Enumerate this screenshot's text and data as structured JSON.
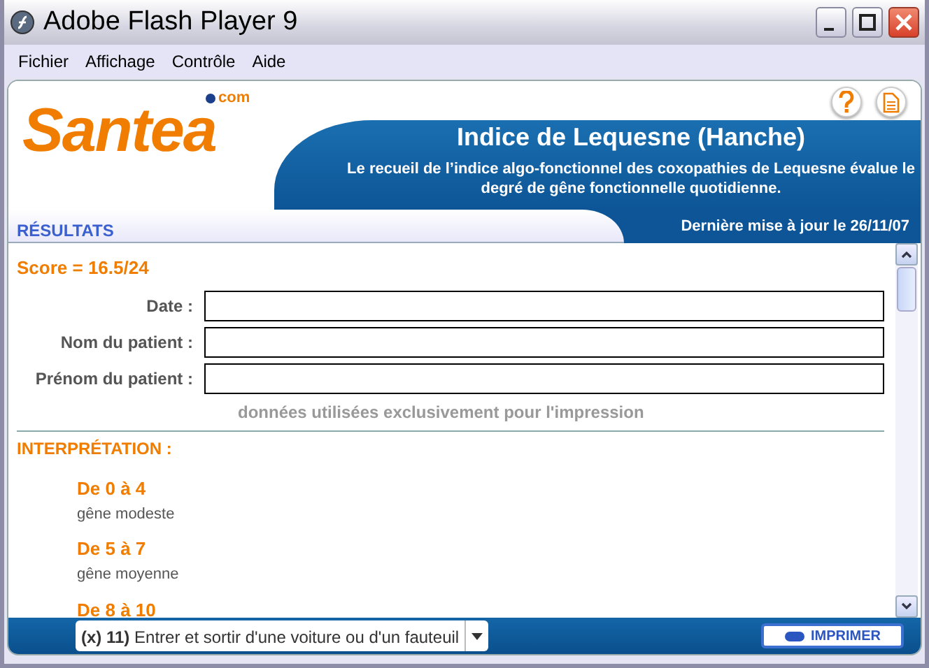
{
  "window": {
    "title": "Adobe Flash Player 9"
  },
  "menu": [
    "Fichier",
    "Affichage",
    "Contrôle",
    "Aide"
  ],
  "header": {
    "logo": "Santea",
    "logo_suffix": "com",
    "title": "Indice de Lequesne (Hanche)",
    "subtitle": "Le recueil de l’indice algo-fonctionnel des coxopathies de Lequesne évalue le degré de gêne fonctionnelle quotidienne."
  },
  "results_bar": {
    "label": "RÉSULTATS",
    "updated": "Dernière mise à jour le 26/11/07"
  },
  "score": "Score = 16.5/24",
  "fields": [
    {
      "label": "Date :"
    },
    {
      "label": "Nom du patient :"
    },
    {
      "label": "Prénom du patient :"
    }
  ],
  "note": "données utilisées exclusivement pour l'impression",
  "interpretation": {
    "heading": "INTERPRÉTATION :",
    "ranges": [
      {
        "range": "De 0 à 4",
        "description": "gêne modeste"
      },
      {
        "range": "De 5 à 7",
        "description": "gêne moyenne"
      },
      {
        "range": "De 8 à 10"
      }
    ]
  },
  "footer": {
    "question": "**(x) 11)** Entrer et sortir d'une voiture ou d'un fauteuil",
    "print_button": "IMPRIMER"
  }
}
